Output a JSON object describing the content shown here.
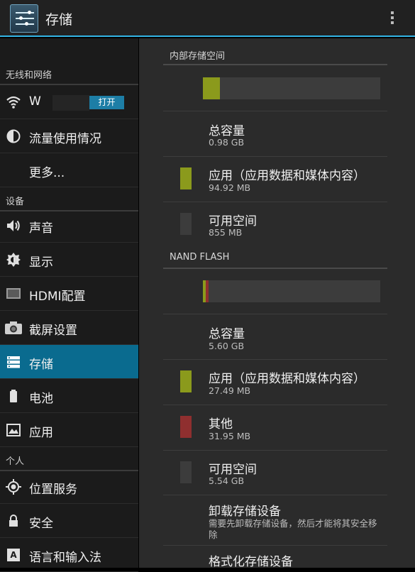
{
  "app": {
    "title": "存储"
  },
  "sidebar": {
    "sections": [
      {
        "label": "无线和网络"
      },
      {
        "label": "设备"
      },
      {
        "label": "个人"
      }
    ],
    "items": [
      {
        "label": "W",
        "icon": "wifi-icon",
        "toggle": "打开"
      },
      {
        "label": "流量使用情况",
        "icon": "data-usage-icon"
      },
      {
        "label": "更多...",
        "icon": ""
      },
      {
        "label": "声音",
        "icon": "speaker-icon"
      },
      {
        "label": "显示",
        "icon": "brightness-icon"
      },
      {
        "label": "HDMI配置",
        "icon": "hdmi-icon"
      },
      {
        "label": "截屏设置",
        "icon": "camera-icon"
      },
      {
        "label": "存储",
        "icon": "storage-icon",
        "selected": true
      },
      {
        "label": "电池",
        "icon": "battery-icon"
      },
      {
        "label": "应用",
        "icon": "apps-icon"
      },
      {
        "label": "位置服务",
        "icon": "location-icon"
      },
      {
        "label": "安全",
        "icon": "lock-icon"
      },
      {
        "label": "语言和输入法",
        "icon": "keyboard-icon"
      }
    ]
  },
  "internal": {
    "header": "内部存储空间",
    "bar": [
      {
        "color": "#8b9a1c",
        "fraction": 0.094
      }
    ],
    "total": {
      "title": "总容量",
      "value": "0.98 GB"
    },
    "apps": {
      "title": "应用（应用数据和媒体内容）",
      "value": "94.92 MB",
      "color": "#8b9a1c"
    },
    "available": {
      "title": "可用空间",
      "value": "855 MB",
      "color": "#3c3c3c"
    }
  },
  "nand": {
    "header": "NAND FLASH",
    "bar": [
      {
        "color": "#8b9a1c",
        "fraction": 0.0048
      },
      {
        "color": "#8f2f2f",
        "fraction": 0.0056
      }
    ],
    "total": {
      "title": "总容量",
      "value": "5.60 GB"
    },
    "apps": {
      "title": "应用（应用数据和媒体内容）",
      "value": "27.49 MB",
      "color": "#8b9a1c"
    },
    "other": {
      "title": "其他",
      "value": "31.95 MB",
      "color": "#8f2f2f"
    },
    "available": {
      "title": "可用空间",
      "value": "5.54 GB",
      "color": "#3c3c3c"
    }
  },
  "unmount": {
    "title": "卸载存储设备",
    "desc": "需要先卸载存储设备，然后才能将其安全移除"
  },
  "format": {
    "title": "格式化存储设备"
  }
}
